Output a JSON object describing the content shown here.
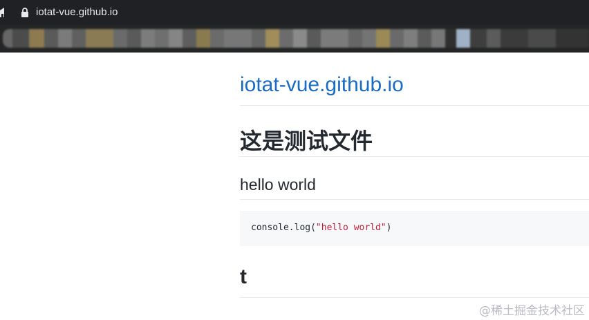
{
  "browser": {
    "url": "iotat-vue.github.io",
    "home_icon": "home-icon",
    "lock_icon": "lock-icon"
  },
  "page": {
    "site_title": "iotat-vue.github.io",
    "heading_1": "这是测试文件",
    "heading_2": "hello world",
    "code": {
      "prefix": "console.log(",
      "string": "\"hello world\"",
      "suffix": ")"
    },
    "heading_t": "t"
  },
  "watermark": "@稀土掘金技术社区",
  "colors": {
    "link": "#1a6bc3",
    "code_string": "#c31d3a",
    "code_background": "#f6f8fa",
    "toolbar": "#202124"
  }
}
